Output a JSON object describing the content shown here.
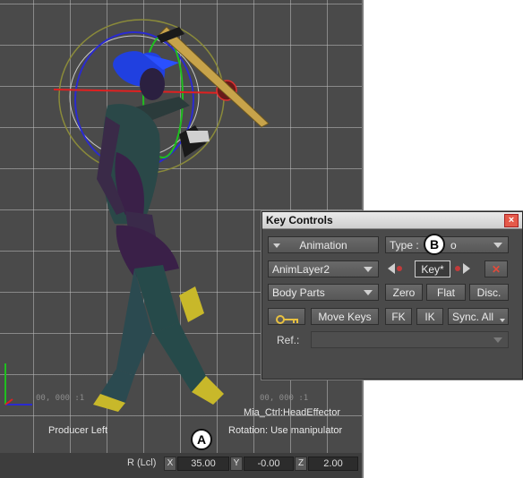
{
  "viewport": {
    "camera_label": "Producer Left",
    "effector_label": "Mia_Ctrl:HeadEffector",
    "manipulator_label": "Rotation: Use manipulator",
    "faint_coords": [
      "00, 000 :1",
      "00, 000 :1"
    ]
  },
  "statusbar": {
    "mode_label": "R (Lcl)",
    "x_axis": "X",
    "x_value": "35.00",
    "y_axis": "Y",
    "y_value": "-0.00",
    "z_axis": "Z",
    "z_value": "2.00"
  },
  "callouts": {
    "a": "A",
    "b": "B"
  },
  "key_controls": {
    "title": "Key Controls",
    "close_glyph": "×",
    "animation_button": "Animation",
    "type_label": "Type :",
    "type_value": "o",
    "anim_layer": "AnimLayer2",
    "key_button": "Key*",
    "delete_glyph": "✕",
    "body_parts": "Body Parts",
    "zero_button": "Zero",
    "flat_button": "Flat",
    "disc_button": "Disc.",
    "move_keys_button": "Move Keys",
    "fk_button": "FK",
    "ik_button": "IK",
    "sync_all_button": "Sync. All",
    "ref_label": "Ref.:",
    "ref_value": ""
  },
  "colors": {
    "viewport_bg": "#4a4a4a",
    "panel_bg": "#4a4a4a",
    "close_red": "#e55a4a",
    "key_dot_red": "#c23b3b"
  }
}
